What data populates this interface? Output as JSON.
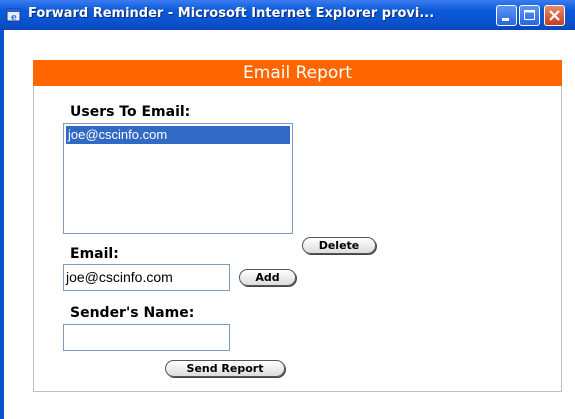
{
  "window": {
    "title": "Forward Reminder - Microsoft Internet Explorer provi..."
  },
  "report": {
    "header": "Email Report",
    "users_label": "Users To Email:",
    "users": [
      "joe@cscinfo.com"
    ],
    "delete_label": "Delete",
    "email_label": "Email:",
    "email_value": "joe@cscinfo.com",
    "add_label": "Add",
    "sender_label": "Sender's Name:",
    "sender_value": "",
    "send_label": "Send Report"
  },
  "colors": {
    "header_orange": "#ff6600",
    "titlebar_blue": "#0a54cf",
    "selection_blue": "#316ac5"
  }
}
